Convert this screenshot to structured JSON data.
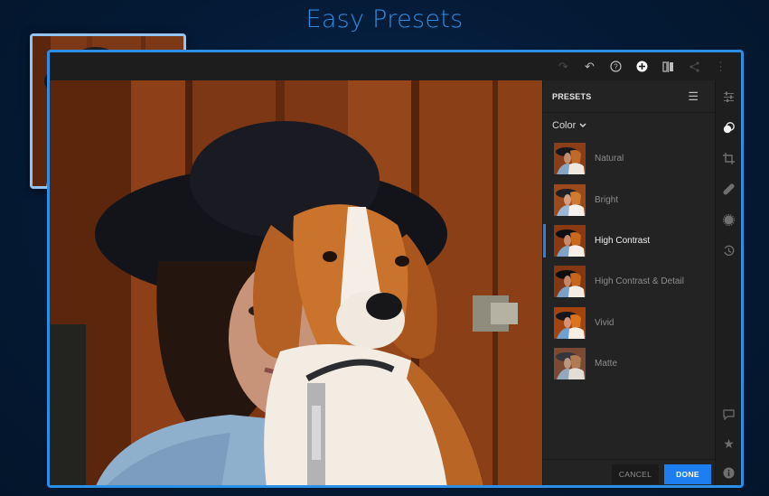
{
  "headline": "Easy Presets",
  "toolbar": {
    "buttons": [
      {
        "name": "redo",
        "glyph": "↷",
        "state": "disabled"
      },
      {
        "name": "undo",
        "glyph": "↶",
        "state": "normal"
      },
      {
        "name": "help",
        "glyph": "?",
        "state": "normal"
      },
      {
        "name": "add",
        "glyph": "+",
        "state": "highlight"
      },
      {
        "name": "compare",
        "glyph": "◧",
        "state": "normal"
      },
      {
        "name": "share",
        "glyph": "<",
        "state": "disabled"
      },
      {
        "name": "more",
        "glyph": "⋮",
        "state": "disabled"
      }
    ]
  },
  "panel": {
    "title": "PRESETS",
    "menu_glyph": "☰",
    "group": "Color",
    "presets": [
      {
        "label": "Natural",
        "active": false
      },
      {
        "label": "Bright",
        "active": false
      },
      {
        "label": "High Contrast",
        "active": true
      },
      {
        "label": "High Contrast & Detail",
        "active": false
      },
      {
        "label": "Vivid",
        "active": false
      },
      {
        "label": "Matte",
        "active": false
      }
    ],
    "cancel_label": "CANCEL",
    "done_label": "DONE"
  },
  "rail": {
    "top": [
      "edit-sliders",
      "presets",
      "crop",
      "healing-brush",
      "selective",
      "versions"
    ],
    "bottom": [
      "comments",
      "rating",
      "info"
    ],
    "active": "presets"
  },
  "colors": {
    "accent": "#2c8fe6",
    "done_button": "#1c7ef0",
    "headline": "#2f8be0",
    "background": "#041a35"
  }
}
